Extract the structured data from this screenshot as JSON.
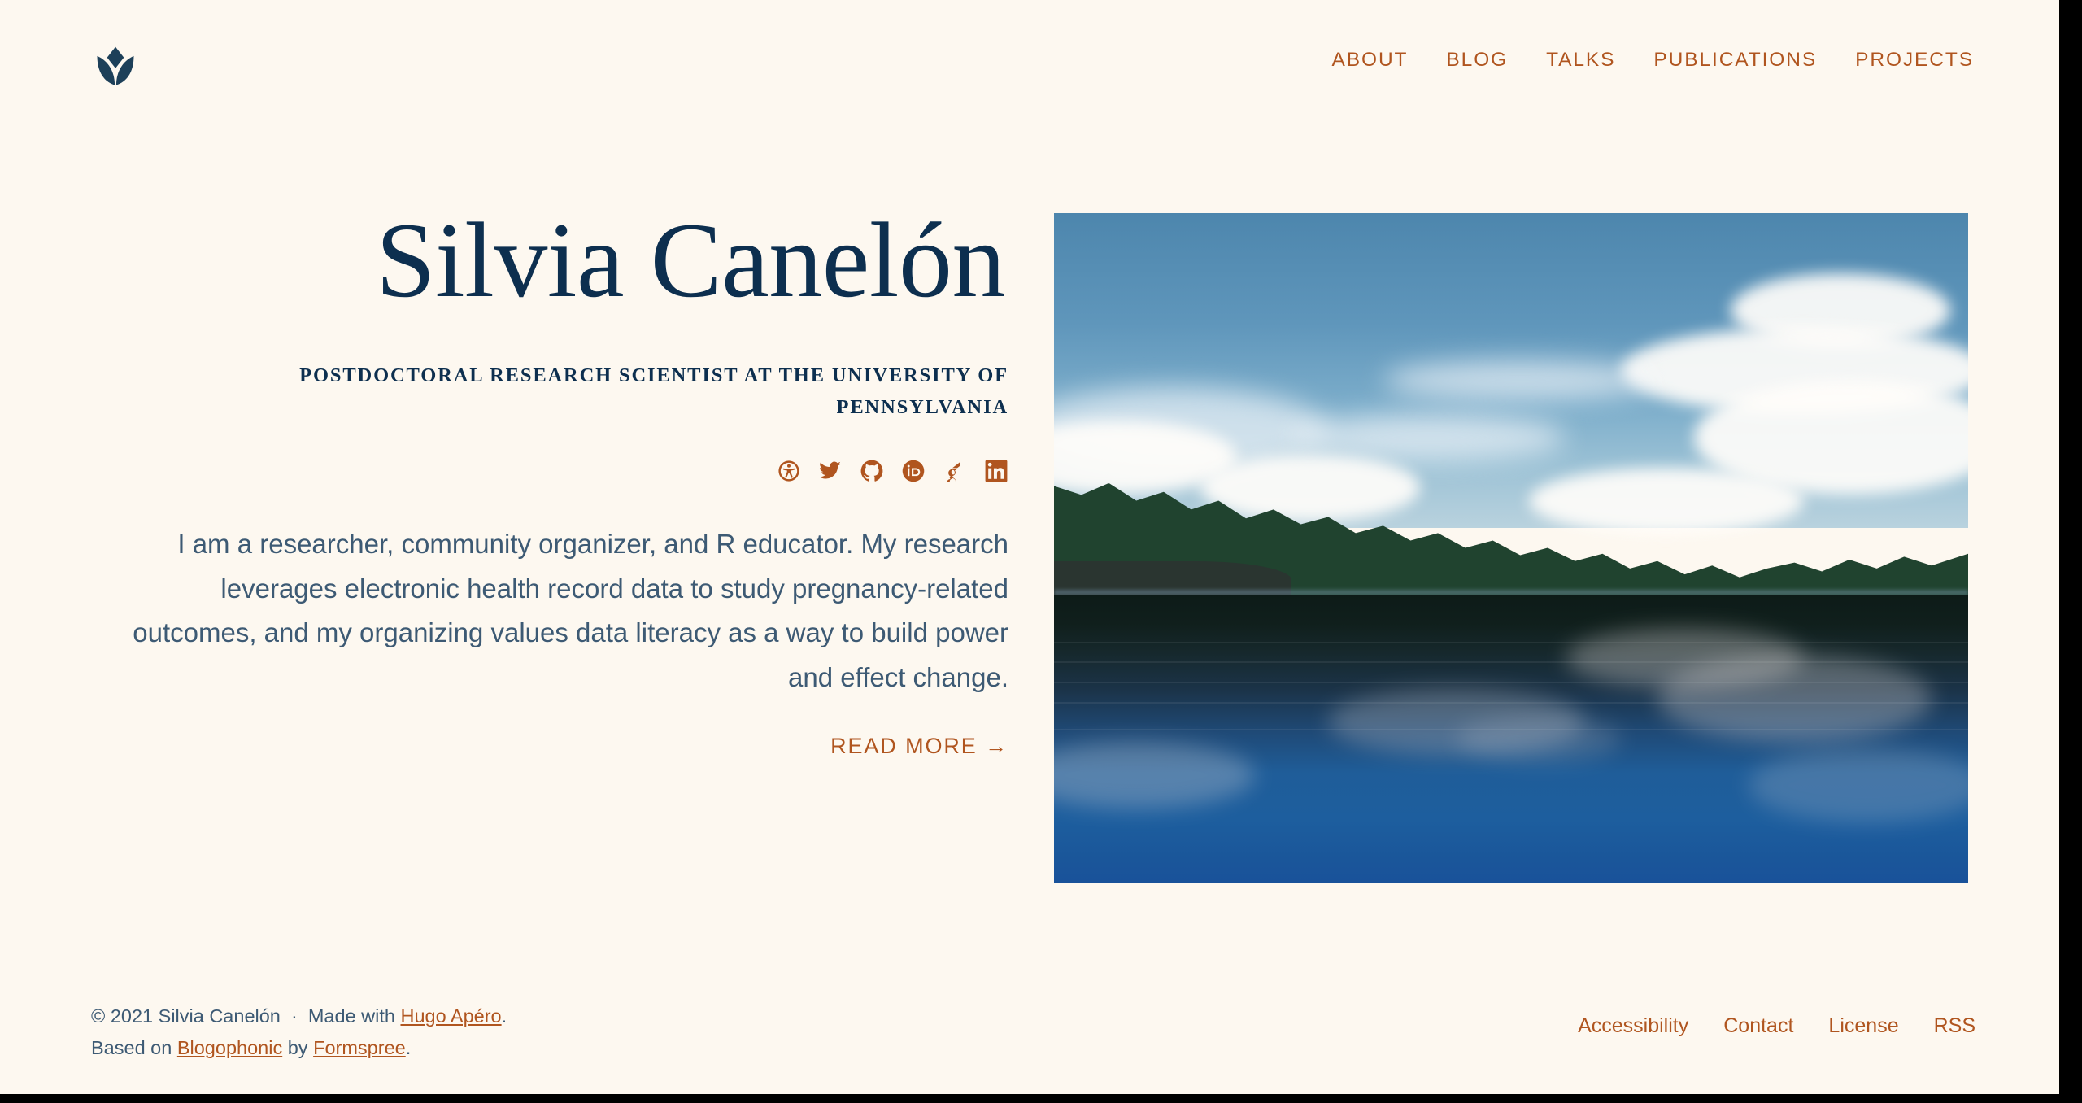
{
  "theme": {
    "background": "#fdf8f0",
    "accent": "#b0551f",
    "heading": "#0d2f4f",
    "body_text": "#3d5a74"
  },
  "header": {
    "logo_name": "tulip-logo",
    "nav": [
      {
        "label": "ABOUT"
      },
      {
        "label": "BLOG"
      },
      {
        "label": "TALKS"
      },
      {
        "label": "PUBLICATIONS"
      },
      {
        "label": "PROJECTS"
      }
    ]
  },
  "hero": {
    "title": "Silvia Canelón",
    "subtitle": "POSTDOCTORAL RESEARCH SCIENTIST AT THE UNIVERSITY OF PENNSYLVANIA",
    "bio": "I am a researcher, community organizer, and R educator. My research leverages electronic health record data to study pregnancy-related outcomes, and my organizing values data literacy as a way to build power and effect change.",
    "read_more": "READ MORE  →",
    "social": [
      {
        "name": "accessibility-icon",
        "label": "Accessibility"
      },
      {
        "name": "twitter-icon",
        "label": "Twitter"
      },
      {
        "name": "github-icon",
        "label": "GitHub"
      },
      {
        "name": "orcid-icon",
        "label": "ORCID"
      },
      {
        "name": "google-scholar-icon",
        "label": "Google Scholar"
      },
      {
        "name": "linkedin-icon",
        "label": "LinkedIn"
      }
    ],
    "image_alt": "Lake at dusk with evergreen treeline and clouds reflected in still water"
  },
  "footer": {
    "copyright": "© 2021 Silvia Canelón",
    "separator": "  ·  ",
    "made_with_prefix": "Made with ",
    "made_with_link": "Hugo Apéro",
    "made_with_suffix": ".",
    "based_on_prefix": "Based on ",
    "based_on_link": "Blogophonic",
    "based_on_mid": " by ",
    "based_on_link2": "Formspree",
    "based_on_suffix": ".",
    "links": [
      {
        "label": "Accessibility"
      },
      {
        "label": "Contact"
      },
      {
        "label": "License"
      },
      {
        "label": "RSS"
      }
    ]
  }
}
